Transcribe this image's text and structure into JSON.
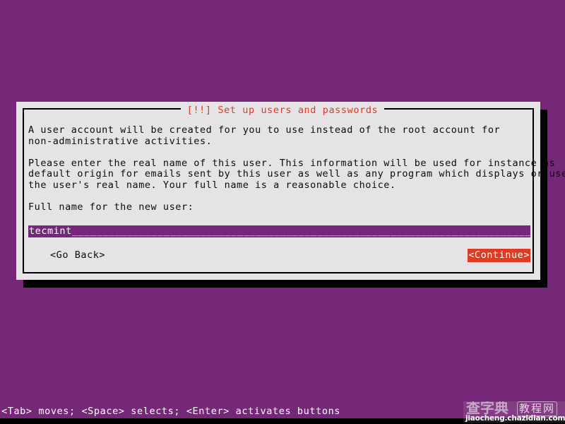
{
  "screen": {
    "background_color": "#762878",
    "bottom_strip_color": "#000000"
  },
  "dialog": {
    "title": "[!!] Set up users and passwords",
    "title_color": "#dd3b22",
    "background_color": "#e6e3e7",
    "border_color": "#000000",
    "paragraphs": [
      "A user account will be created for you to use instead of the root account for\nnon-administrative activities.",
      "Please enter the real name of this user. This information will be used for instance as\ndefault origin for emails sent by this user as well as any program which displays or uses\nthe user's real name. Your full name is a reasonable choice.",
      "Full name for the new user:"
    ],
    "input": {
      "value": "tecmint_______________________________________________________________________________",
      "text_value": "tecmint",
      "placeholder": "",
      "background_color": "#77277b",
      "text_color": "#ffffff"
    },
    "buttons": {
      "go_back": "<Go Back>",
      "continue": "<Continue>",
      "continue_selected": true,
      "continue_background_color": "#dd3b22",
      "continue_text_color": "#ffffff"
    }
  },
  "status_bar": {
    "text": "<Tab> moves; <Space> selects; <Enter> activates buttons",
    "text_color": "#ffffff"
  },
  "watermark": {
    "logo_cn": "查字典",
    "badge_cn": "教程网",
    "url": "jiaocheng.chazidian.com"
  }
}
